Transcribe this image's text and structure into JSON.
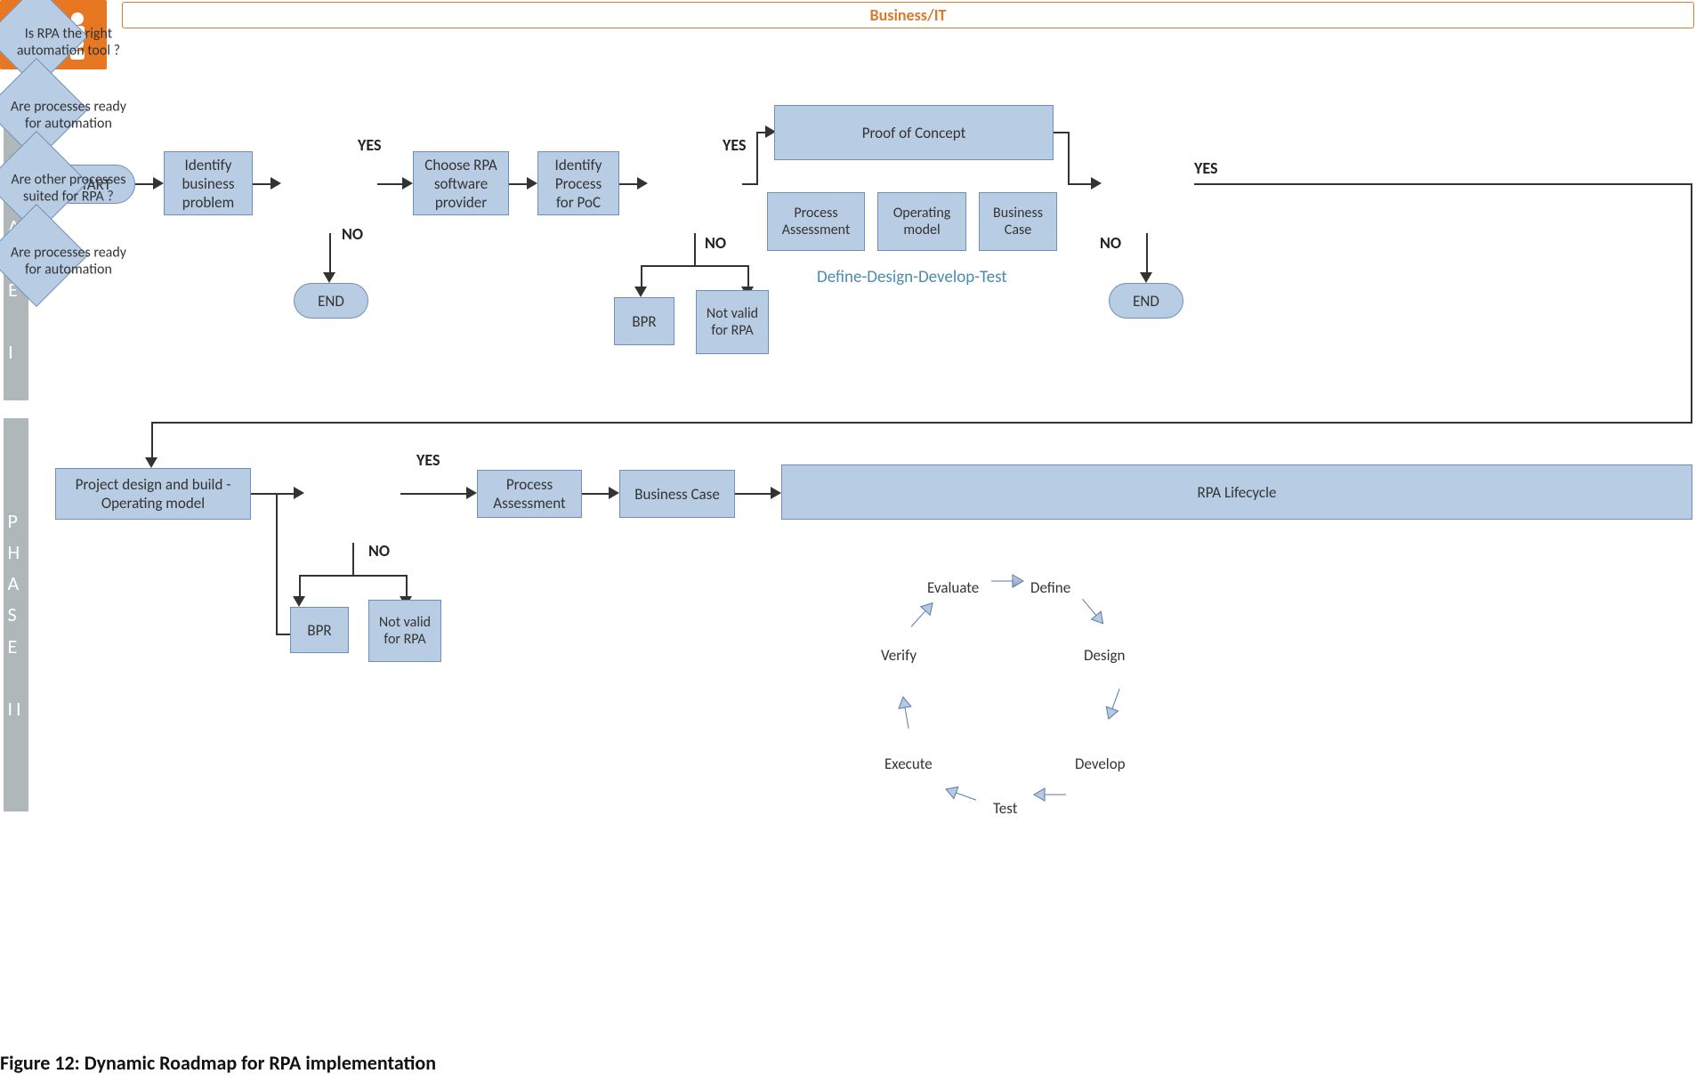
{
  "header": {
    "lane_title": "Business/IT"
  },
  "phases": {
    "one": "P\nH\nA\nS\nE\n\nI",
    "two": "P\nH\nA\nS\nE\n\nII"
  },
  "p1": {
    "start": "START",
    "identify_problem": "Identify business problem",
    "decision_tool": "Is RPA the right automation tool ?",
    "choose_provider": "Choose RPA software provider",
    "identify_poc": "Identify Process for PoC",
    "decision_ready": "Are processes ready for automation",
    "poc": "Proof of Concept",
    "process_assessment": "Process Assessment",
    "operating_model": "Operating model",
    "business_case": "Business Case",
    "define_caption": "Define-Design-Develop-Test",
    "decision_other": "Are other processes suited for RPA ?",
    "bpr": "BPR",
    "not_valid": "Not valid for RPA",
    "end": "END",
    "end2": "END",
    "yes": "YES",
    "no": "NO"
  },
  "p2": {
    "project_design": "Project design and build - Operating model",
    "decision_ready": "Are processes ready for automation",
    "process_assessment": "Process Assessment",
    "business_case": "Business Case",
    "rpa_lifecycle": "RPA Lifecycle",
    "bpr": "BPR",
    "not_valid": "Not valid for RPA",
    "yes": "YES",
    "no": "NO"
  },
  "cycle": {
    "evaluate": "Evaluate",
    "define": "Define",
    "design": "Design",
    "develop": "Develop",
    "test": "Test",
    "execute": "Execute",
    "verify": "Verify"
  },
  "caption": "Figure 12: Dynamic Roadmap for RPA implementation"
}
